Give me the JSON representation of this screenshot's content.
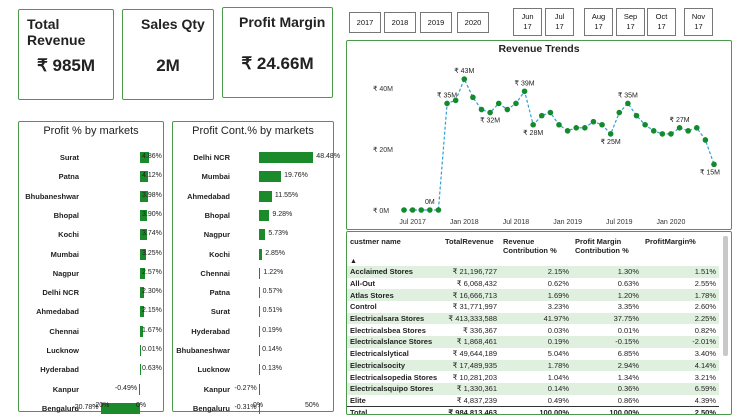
{
  "kpis": {
    "total_revenue": {
      "title": "Total Revenue",
      "value": "₹ 985M"
    },
    "sales_qty": {
      "title": "Sales Qty",
      "value": "2M"
    },
    "profit_margin": {
      "title": "Profit Margin",
      "value": "₹ 24.66M"
    }
  },
  "year_buttons": [
    "2017",
    "2018",
    "2019",
    "2020"
  ],
  "month_buttons": [
    {
      "m": "Jun",
      "y": "17"
    },
    {
      "m": "Jul",
      "y": "17"
    },
    {
      "m": "Aug",
      "y": "17"
    },
    {
      "m": "Sep",
      "y": "17"
    },
    {
      "m": "Oct",
      "y": "17"
    },
    {
      "m": "Nov",
      "y": "17"
    }
  ],
  "profit_pct_panel": {
    "title": "Profit % by markets",
    "rows": [
      {
        "label": "Surat",
        "value": 4.86,
        "text": "4.86%"
      },
      {
        "label": "Patna",
        "value": 4.12,
        "text": "4.12%"
      },
      {
        "label": "Bhubaneshwar",
        "value": 3.98,
        "text": "3.98%"
      },
      {
        "label": "Bhopal",
        "value": 3.9,
        "text": "3.90%"
      },
      {
        "label": "Kochi",
        "value": 3.74,
        "text": "3.74%"
      },
      {
        "label": "Mumbai",
        "value": 3.25,
        "text": "3.25%"
      },
      {
        "label": "Nagpur",
        "value": 2.57,
        "text": "2.57%"
      },
      {
        "label": "Delhi NCR",
        "value": 2.3,
        "text": "2.30%"
      },
      {
        "label": "Ahmedabad",
        "value": 2.15,
        "text": "2.15%"
      },
      {
        "label": "Chennai",
        "value": 1.67,
        "text": "1.67%"
      },
      {
        "label": "Lucknow",
        "value": 0.01,
        "text": "0.01%"
      },
      {
        "label": "Hyderabad",
        "value": 0.63,
        "text": "0.63%"
      },
      {
        "label": "Kanpur",
        "value": -0.49,
        "text": "-0.49%"
      },
      {
        "label": "Bengaluru",
        "value": -20.78,
        "text": "-20.78%"
      }
    ],
    "axis": [
      "-20%",
      "0%"
    ]
  },
  "profit_cont_panel": {
    "title": "Profit Cont.% by markets",
    "rows": [
      {
        "label": "Delhi NCR",
        "value": 48.48,
        "text": "48.48%"
      },
      {
        "label": "Mumbai",
        "value": 19.76,
        "text": "19.76%"
      },
      {
        "label": "Ahmedabad",
        "value": 11.55,
        "text": "11.55%"
      },
      {
        "label": "Bhopal",
        "value": 9.28,
        "text": "9.28%"
      },
      {
        "label": "Nagpur",
        "value": 5.73,
        "text": "5.73%"
      },
      {
        "label": "Kochi",
        "value": 2.85,
        "text": "2.85%"
      },
      {
        "label": "Chennai",
        "value": 1.22,
        "text": "1.22%"
      },
      {
        "label": "Patna",
        "value": 0.57,
        "text": "0.57%"
      },
      {
        "label": "Surat",
        "value": 0.51,
        "text": "0.51%"
      },
      {
        "label": "Hyderabad",
        "value": 0.19,
        "text": "0.19%"
      },
      {
        "label": "Bhubaneshwar",
        "value": 0.14,
        "text": "0.14%"
      },
      {
        "label": "Lucknow",
        "value": 0.13,
        "text": "0.13%"
      },
      {
        "label": "Kanpur",
        "value": -0.27,
        "text": "-0.27%"
      },
      {
        "label": "Bengaluru",
        "value": -0.31,
        "text": "-0.31%"
      }
    ],
    "axis": [
      "0%",
      "50%"
    ]
  },
  "chart_data": {
    "type": "line",
    "title": "Revenue Trends",
    "x": [
      "2017-06",
      "2017-07",
      "2017-08",
      "2017-09",
      "2017-10",
      "2017-11",
      "2017-12",
      "2018-01",
      "2018-02",
      "2018-03",
      "2018-04",
      "2018-05",
      "2018-06",
      "2018-07",
      "2018-08",
      "2018-09",
      "2018-10",
      "2018-11",
      "2018-12",
      "2019-01",
      "2019-02",
      "2019-03",
      "2019-04",
      "2019-05",
      "2019-06",
      "2019-07",
      "2019-08",
      "2019-09",
      "2019-10",
      "2019-11",
      "2019-12",
      "2020-01",
      "2020-02",
      "2020-03",
      "2020-04",
      "2020-05",
      "2020-06"
    ],
    "y": [
      0,
      0,
      0,
      0,
      0,
      35,
      36,
      43,
      37,
      33,
      32,
      35,
      33,
      35,
      39,
      28,
      31,
      32,
      28,
      26,
      27,
      27,
      29,
      28,
      25,
      32,
      35,
      31,
      28,
      26,
      25,
      25,
      27,
      26,
      27,
      23,
      15
    ],
    "data_labels": [
      {
        "index": 3,
        "text": "0M"
      },
      {
        "index": 5,
        "text": "₹ 35M"
      },
      {
        "index": 7,
        "text": "₹ 43M"
      },
      {
        "index": 10,
        "text": "₹ 32M"
      },
      {
        "index": 14,
        "text": "₹ 39M"
      },
      {
        "index": 15,
        "text": "₹ 28M"
      },
      {
        "index": 24,
        "text": "₹ 25M"
      },
      {
        "index": 26,
        "text": "₹ 35M"
      },
      {
        "index": 32,
        "text": "₹ 27M"
      },
      {
        "index": 36,
        "text": "₹ 15M"
      }
    ],
    "yticks": [
      {
        "v": 0,
        "label": "₹ 0M"
      },
      {
        "v": 20,
        "label": "₹ 20M"
      },
      {
        "v": 40,
        "label": "₹ 40M"
      }
    ],
    "xticks": [
      {
        "index": 1,
        "label": "Jul 2017"
      },
      {
        "index": 7,
        "label": "Jan 2018"
      },
      {
        "index": 13,
        "label": "Jul 2018"
      },
      {
        "index": 19,
        "label": "Jan 2019"
      },
      {
        "index": 25,
        "label": "Jul 2019"
      },
      {
        "index": 31,
        "label": "Jan 2020"
      }
    ],
    "ylim": [
      0,
      45
    ],
    "line_color": "#2f9fd8",
    "marker_color": "#138a2b"
  },
  "table": {
    "headers": [
      "custmer name",
      "TotalRevenue",
      "Revenue Contribution %",
      "Profit Margin Contribution %",
      "ProfitMargin%"
    ],
    "rows": [
      [
        "Acclaimed Stores",
        "₹ 21,196,727",
        "2.15%",
        "1.30%",
        "1.51%"
      ],
      [
        "All-Out",
        "₹ 6,068,432",
        "0.62%",
        "0.63%",
        "2.55%"
      ],
      [
        "Atlas Stores",
        "₹ 16,666,713",
        "1.69%",
        "1.20%",
        "1.78%"
      ],
      [
        "Control",
        "₹ 31,771,997",
        "3.23%",
        "3.35%",
        "2.60%"
      ],
      [
        "Electricalsara Stores",
        "₹ 413,333,588",
        "41.97%",
        "37.75%",
        "2.25%"
      ],
      [
        "Electricalsbea Stores",
        "₹ 336,367",
        "0.03%",
        "0.01%",
        "0.82%"
      ],
      [
        "Electricalslance Stores",
        "₹ 1,868,461",
        "0.19%",
        "-0.15%",
        "-2.01%"
      ],
      [
        "Electricalslytical",
        "₹ 49,644,189",
        "5.04%",
        "6.85%",
        "3.40%"
      ],
      [
        "Electricalsocity",
        "₹ 17,489,935",
        "1.78%",
        "2.94%",
        "4.14%"
      ],
      [
        "Electricalsopedia Stores",
        "₹ 10,281,203",
        "1.04%",
        "1.34%",
        "3.21%"
      ],
      [
        "Electricalsquipo Stores",
        "₹ 1,330,361",
        "0.14%",
        "0.36%",
        "6.59%"
      ],
      [
        "Elite",
        "₹ 4,837,239",
        "0.49%",
        "0.86%",
        "4.39%"
      ]
    ],
    "total": [
      "Total",
      "₹ 984,813,463",
      "100.00%",
      "100.00%",
      "2.50%"
    ]
  }
}
